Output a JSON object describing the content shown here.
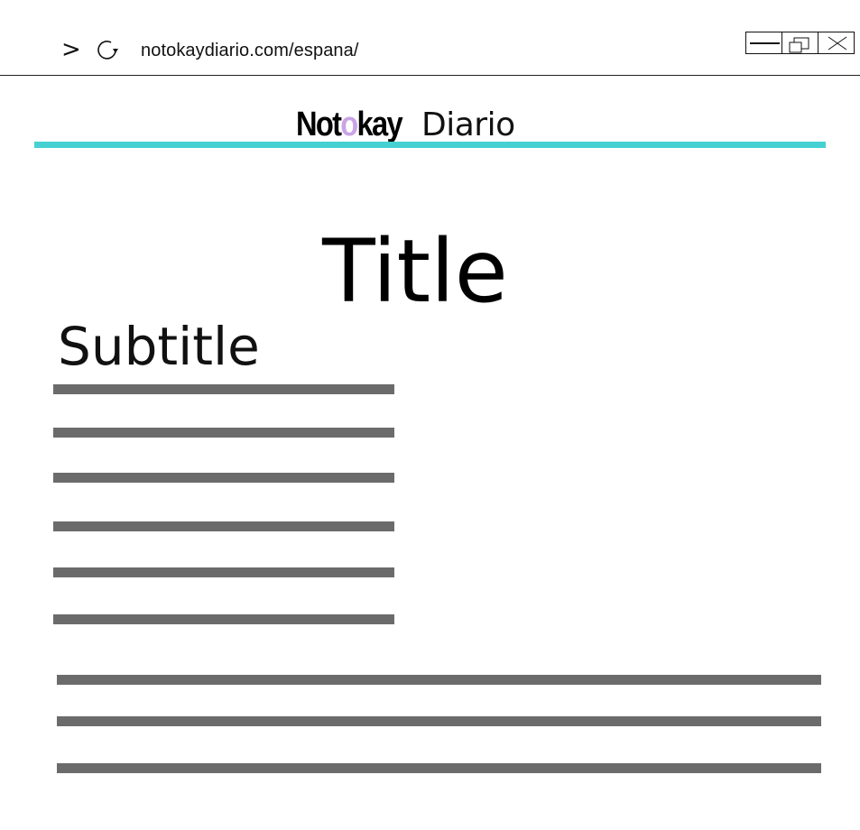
{
  "browser": {
    "url": "notokaydiario.com/espana/",
    "forward_icon": "chevron-right-icon",
    "reload_icon": "reload-icon",
    "window_controls": [
      "minimize-icon",
      "restore-icon",
      "close-icon"
    ]
  },
  "site": {
    "brand_part1": "Not",
    "brand_o": "o",
    "brand_part2": "kay",
    "brand_light": "Diario",
    "accent_color": "#45d1d1",
    "brand_o_color": "#c9a3e6"
  },
  "article": {
    "title": "Title",
    "subtitle": "Subtitle",
    "placeholder_line_color": "#6b6b6b"
  }
}
